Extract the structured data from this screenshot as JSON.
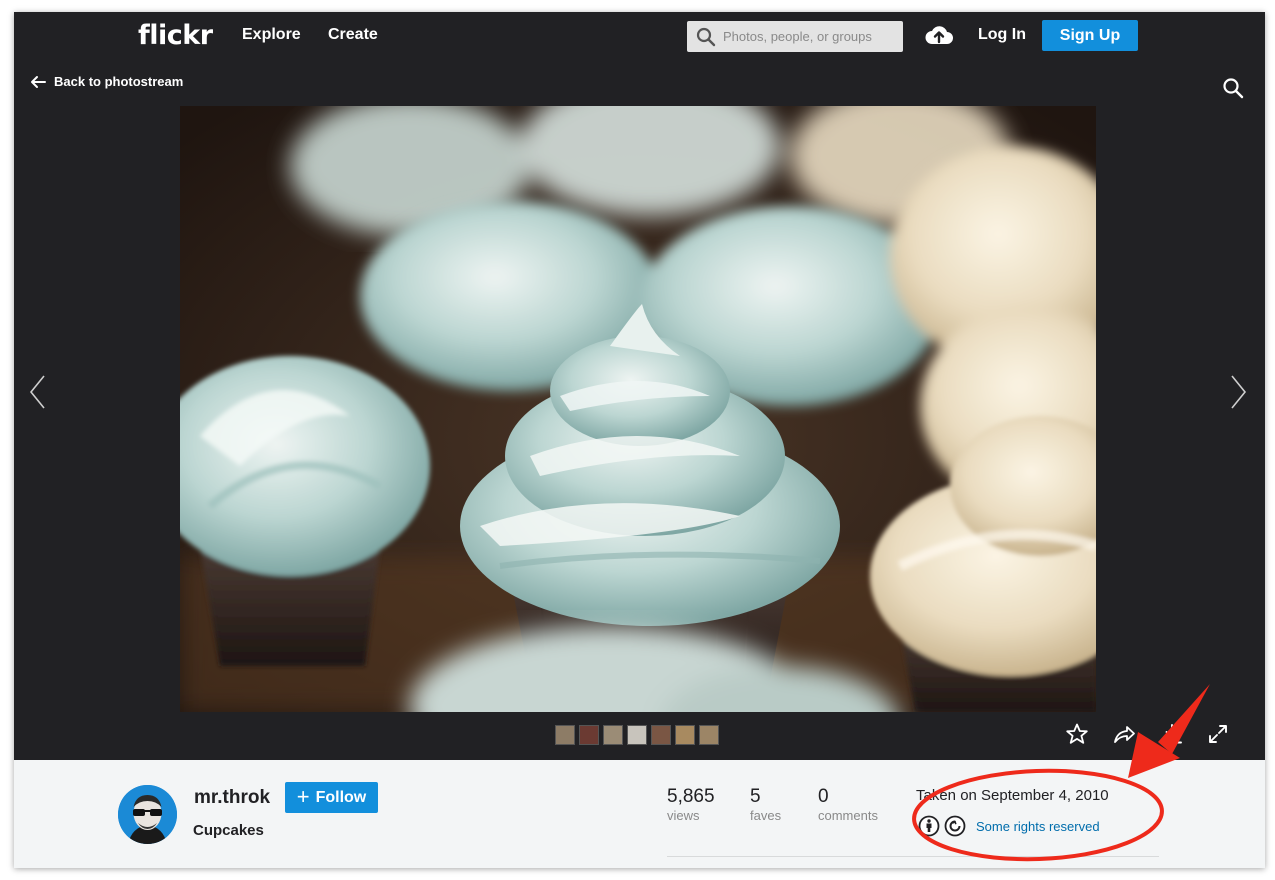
{
  "header": {
    "logo": "flickr",
    "nav": {
      "explore": "Explore",
      "create": "Create"
    },
    "search_placeholder": "Photos, people, or groups",
    "login": "Log In",
    "signup": "Sign Up"
  },
  "photo_view": {
    "back_label": "Back to photostream",
    "thumbnails": [
      "#8d7c66",
      "#6b3a32",
      "#9b8c76",
      "#c8c4bc",
      "#7a5644",
      "#a88a60",
      "#9c8566"
    ]
  },
  "owner": {
    "username": "mr.throk",
    "follow_label": "Follow",
    "photo_title": "Cupcakes"
  },
  "stats": [
    {
      "value": "5,865",
      "label": "views"
    },
    {
      "value": "5",
      "label": "faves"
    },
    {
      "value": "0",
      "label": "comments"
    }
  ],
  "details": {
    "taken": "Taken on September 4, 2010",
    "license": "Some rights reserved"
  },
  "colors": {
    "accent": "#128fdc",
    "link": "#006dac",
    "annotation": "#ee2a1b"
  }
}
